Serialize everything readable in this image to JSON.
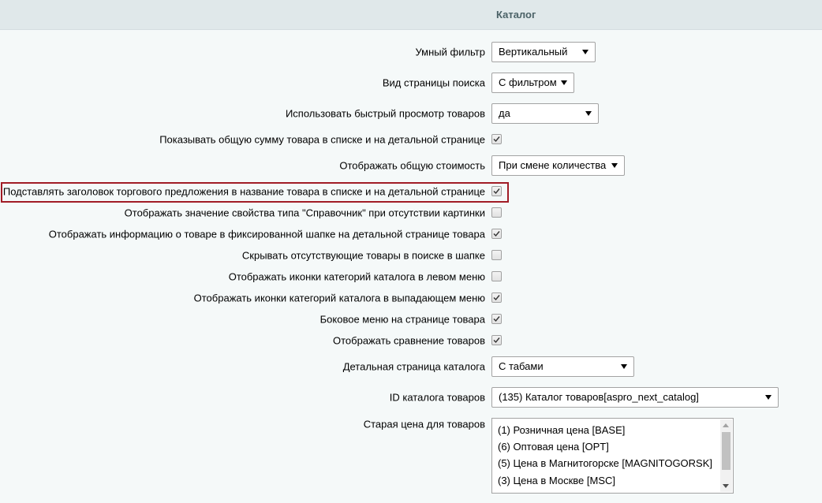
{
  "header": {
    "title": "Каталог"
  },
  "settings": {
    "smart_filter": {
      "label": "Умный фильтр",
      "value": "Вертикальный"
    },
    "search_page_view": {
      "label": "Вид страницы поиска",
      "value": "С фильтром"
    },
    "quick_view": {
      "label": "Использовать быстрый просмотр товаров",
      "value": "да"
    },
    "show_total_sum": {
      "label": "Показывать общую сумму товара в списке и на детальной странице",
      "checked": true
    },
    "show_total_cost": {
      "label": "Отображать общую стоимость",
      "value": "При смене количества"
    },
    "offer_title": {
      "label": "Подставлять заголовок торгового предложения в название товара в списке и на детальной странице",
      "checked": true
    },
    "reference_property": {
      "label": "Отображать значение свойства типа \"Справочник\" при отсутствии картинки",
      "checked": false
    },
    "fixed_header_info": {
      "label": "Отображать информацию о товаре в фиксированной шапке на детальной странице товара",
      "checked": true
    },
    "hide_absent_search": {
      "label": "Скрывать отсутствующие товары в поиске в шапке",
      "checked": false
    },
    "icons_left_menu": {
      "label": "Отображать иконки категорий каталога в левом меню",
      "checked": false
    },
    "icons_dropdown_menu": {
      "label": "Отображать иконки категорий каталога в выпадающем меню",
      "checked": true
    },
    "side_menu": {
      "label": "Боковое меню на странице товара",
      "checked": true
    },
    "compare": {
      "label": "Отображать сравнение товаров",
      "checked": true
    },
    "detail_page": {
      "label": "Детальная страница каталога",
      "value": "С табами"
    },
    "catalog_id": {
      "label": "ID каталога товаров",
      "value": "(135) Каталог товаров[aspro_next_catalog]"
    },
    "old_price": {
      "label": "Старая цена для товаров",
      "options": [
        "(1) Розничная цена [BASE]",
        "(6) Оптовая цена [OPT]",
        "(5) Цена в Магнитогорске [MAGNITOGORSK]",
        "(3) Цена в Москве [MSC]"
      ]
    }
  },
  "highlight_color": "#a11c26"
}
